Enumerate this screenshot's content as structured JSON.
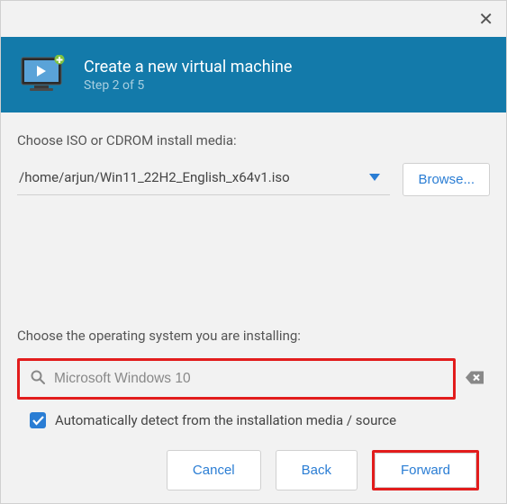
{
  "banner": {
    "title": "Create a new virtual machine",
    "subtitle": "Step 2 of 5"
  },
  "media": {
    "label": "Choose ISO or CDROM install media:",
    "selected": "/home/arjun/Win11_22H2_English_x64v1.iso",
    "browse_label": "Browse..."
  },
  "os": {
    "label": "Choose the operating system you are installing:",
    "input_value": "Microsoft Windows 10",
    "auto_detect_label": "Automatically detect from the installation media / source",
    "auto_detect_checked": true
  },
  "footer": {
    "cancel": "Cancel",
    "back": "Back",
    "forward": "Forward"
  }
}
